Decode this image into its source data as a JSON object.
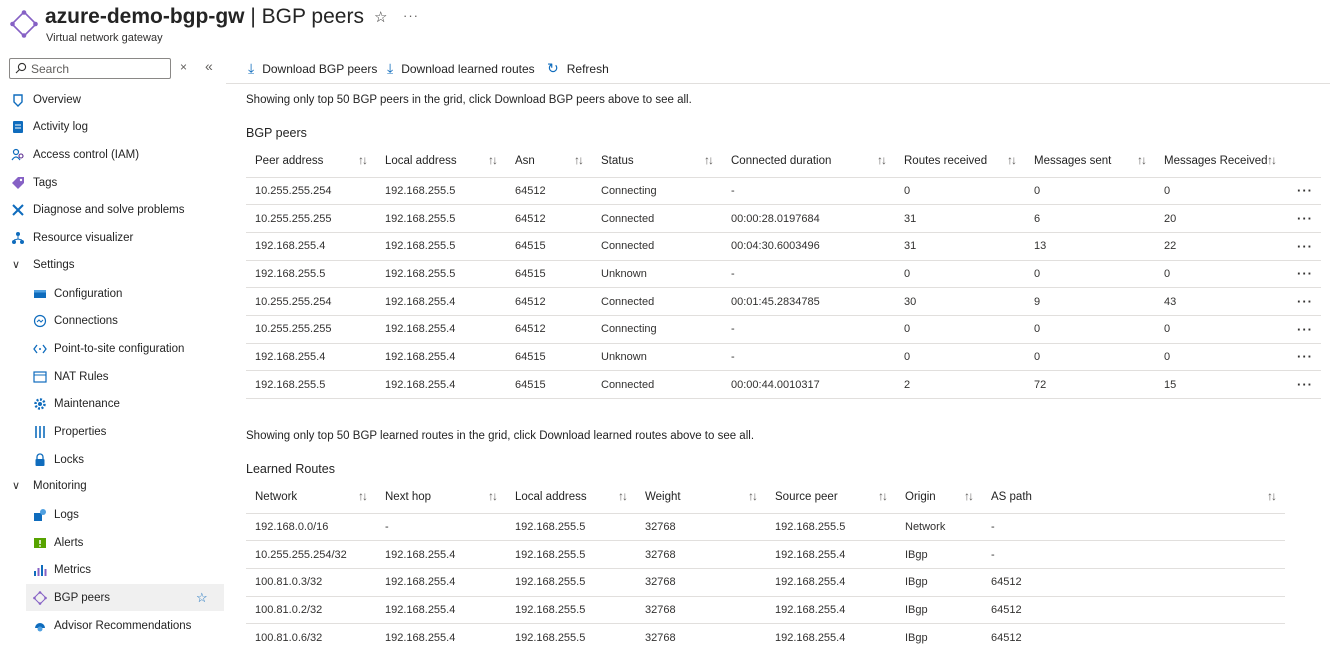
{
  "header": {
    "title_main": "azure-demo-bgp-gw",
    "title_sep": " | BGP peers",
    "subtitle": "Virtual network gateway",
    "star": "☆",
    "more": "···"
  },
  "search": {
    "placeholder": "Search",
    "clear": "×",
    "collapse": "«"
  },
  "sidebar": {
    "items": [
      {
        "label": "Overview",
        "icon": "overview-icon"
      },
      {
        "label": "Activity log",
        "icon": "activity-log-icon"
      },
      {
        "label": "Access control (IAM)",
        "icon": "iam-icon"
      },
      {
        "label": "Tags",
        "icon": "tag-icon"
      },
      {
        "label": "Diagnose and solve problems",
        "icon": "wrench-icon"
      },
      {
        "label": "Resource visualizer",
        "icon": "visualizer-icon"
      }
    ],
    "settings_group": "Settings",
    "settings": [
      {
        "label": "Configuration",
        "icon": "configuration-icon"
      },
      {
        "label": "Connections",
        "icon": "connections-icon"
      },
      {
        "label": "Point-to-site configuration",
        "icon": "point-to-site-icon"
      },
      {
        "label": "NAT Rules",
        "icon": "nat-icon"
      },
      {
        "label": "Maintenance",
        "icon": "gear-icon"
      },
      {
        "label": "Properties",
        "icon": "properties-icon"
      },
      {
        "label": "Locks",
        "icon": "lock-icon"
      }
    ],
    "monitoring_group": "Monitoring",
    "monitoring": [
      {
        "label": "Logs",
        "icon": "logs-icon"
      },
      {
        "label": "Alerts",
        "icon": "alerts-icon"
      },
      {
        "label": "Metrics",
        "icon": "metrics-icon"
      },
      {
        "label": "BGP peers",
        "icon": "bgp-icon",
        "active": true
      },
      {
        "label": "Advisor Recommendations",
        "icon": "advisor-icon"
      }
    ]
  },
  "toolbar": {
    "download_peers": "Download BGP peers",
    "download_routes": "Download learned routes",
    "refresh": "Refresh"
  },
  "peers_note": "Showing only top 50 BGP peers in the grid, click Download BGP peers above to see all.",
  "peers_title": "BGP peers",
  "peers_columns": [
    "Peer address",
    "Local address",
    "Asn",
    "Status",
    "Connected duration",
    "Routes received",
    "Messages sent",
    "Messages Received"
  ],
  "peers_rows": [
    [
      "10.255.255.254",
      "192.168.255.5",
      "64512",
      "Connecting",
      "-",
      "0",
      "0",
      "0"
    ],
    [
      "10.255.255.255",
      "192.168.255.5",
      "64512",
      "Connected",
      "00:00:28.0197684",
      "31",
      "6",
      "20"
    ],
    [
      "192.168.255.4",
      "192.168.255.5",
      "64515",
      "Connected",
      "00:04:30.6003496",
      "31",
      "13",
      "22"
    ],
    [
      "192.168.255.5",
      "192.168.255.5",
      "64515",
      "Unknown",
      "-",
      "0",
      "0",
      "0"
    ],
    [
      "10.255.255.254",
      "192.168.255.4",
      "64512",
      "Connected",
      "00:01:45.2834785",
      "30",
      "9",
      "43"
    ],
    [
      "10.255.255.255",
      "192.168.255.4",
      "64512",
      "Connecting",
      "-",
      "0",
      "0",
      "0"
    ],
    [
      "192.168.255.4",
      "192.168.255.4",
      "64515",
      "Unknown",
      "-",
      "0",
      "0",
      "0"
    ],
    [
      "192.168.255.5",
      "192.168.255.4",
      "64515",
      "Connected",
      "00:00:44.0010317",
      "2",
      "72",
      "15"
    ]
  ],
  "row_more": "···",
  "routes_note": "Showing only top 50 BGP learned routes in the grid, click Download learned routes above to see all.",
  "routes_title": "Learned Routes",
  "routes_columns": [
    "Network",
    "Next hop",
    "Local address",
    "Weight",
    "Source peer",
    "Origin",
    "AS path"
  ],
  "routes_rows": [
    [
      "192.168.0.0/16",
      "-",
      "192.168.255.5",
      "32768",
      "192.168.255.5",
      "Network",
      "-"
    ],
    [
      "10.255.255.254/32",
      "192.168.255.4",
      "192.168.255.5",
      "32768",
      "192.168.255.4",
      "IBgp",
      "-"
    ],
    [
      "100.81.0.3/32",
      "192.168.255.4",
      "192.168.255.5",
      "32768",
      "192.168.255.4",
      "IBgp",
      "64512"
    ],
    [
      "100.81.0.2/32",
      "192.168.255.4",
      "192.168.255.5",
      "32768",
      "192.168.255.4",
      "IBgp",
      "64512"
    ],
    [
      "100.81.0.6/32",
      "192.168.255.4",
      "192.168.255.5",
      "32768",
      "192.168.255.4",
      "IBgp",
      "64512"
    ]
  ],
  "sort_glyph": "↑↓",
  "colors": {
    "accent": "#0f6cbd",
    "border": "#e1dfdd",
    "active_bg": "#f0f0f0"
  }
}
